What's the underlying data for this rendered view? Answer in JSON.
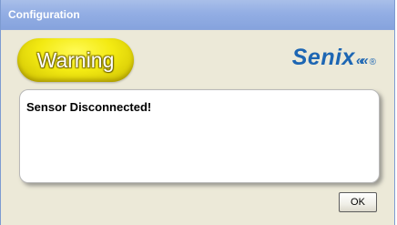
{
  "window": {
    "title": "Configuration"
  },
  "header": {
    "warning_label": "Warning",
    "logo_text": "Senix",
    "logo_mark": "««",
    "logo_registered": "®"
  },
  "message": {
    "text": "Sensor Disconnected!"
  },
  "buttons": {
    "ok_label": "OK"
  },
  "colors": {
    "warning_yellow": "#f3ea12",
    "logo_blue": "#1d66b3",
    "title_bar": "#93aee4",
    "dialog_background": "#ece9d8"
  }
}
